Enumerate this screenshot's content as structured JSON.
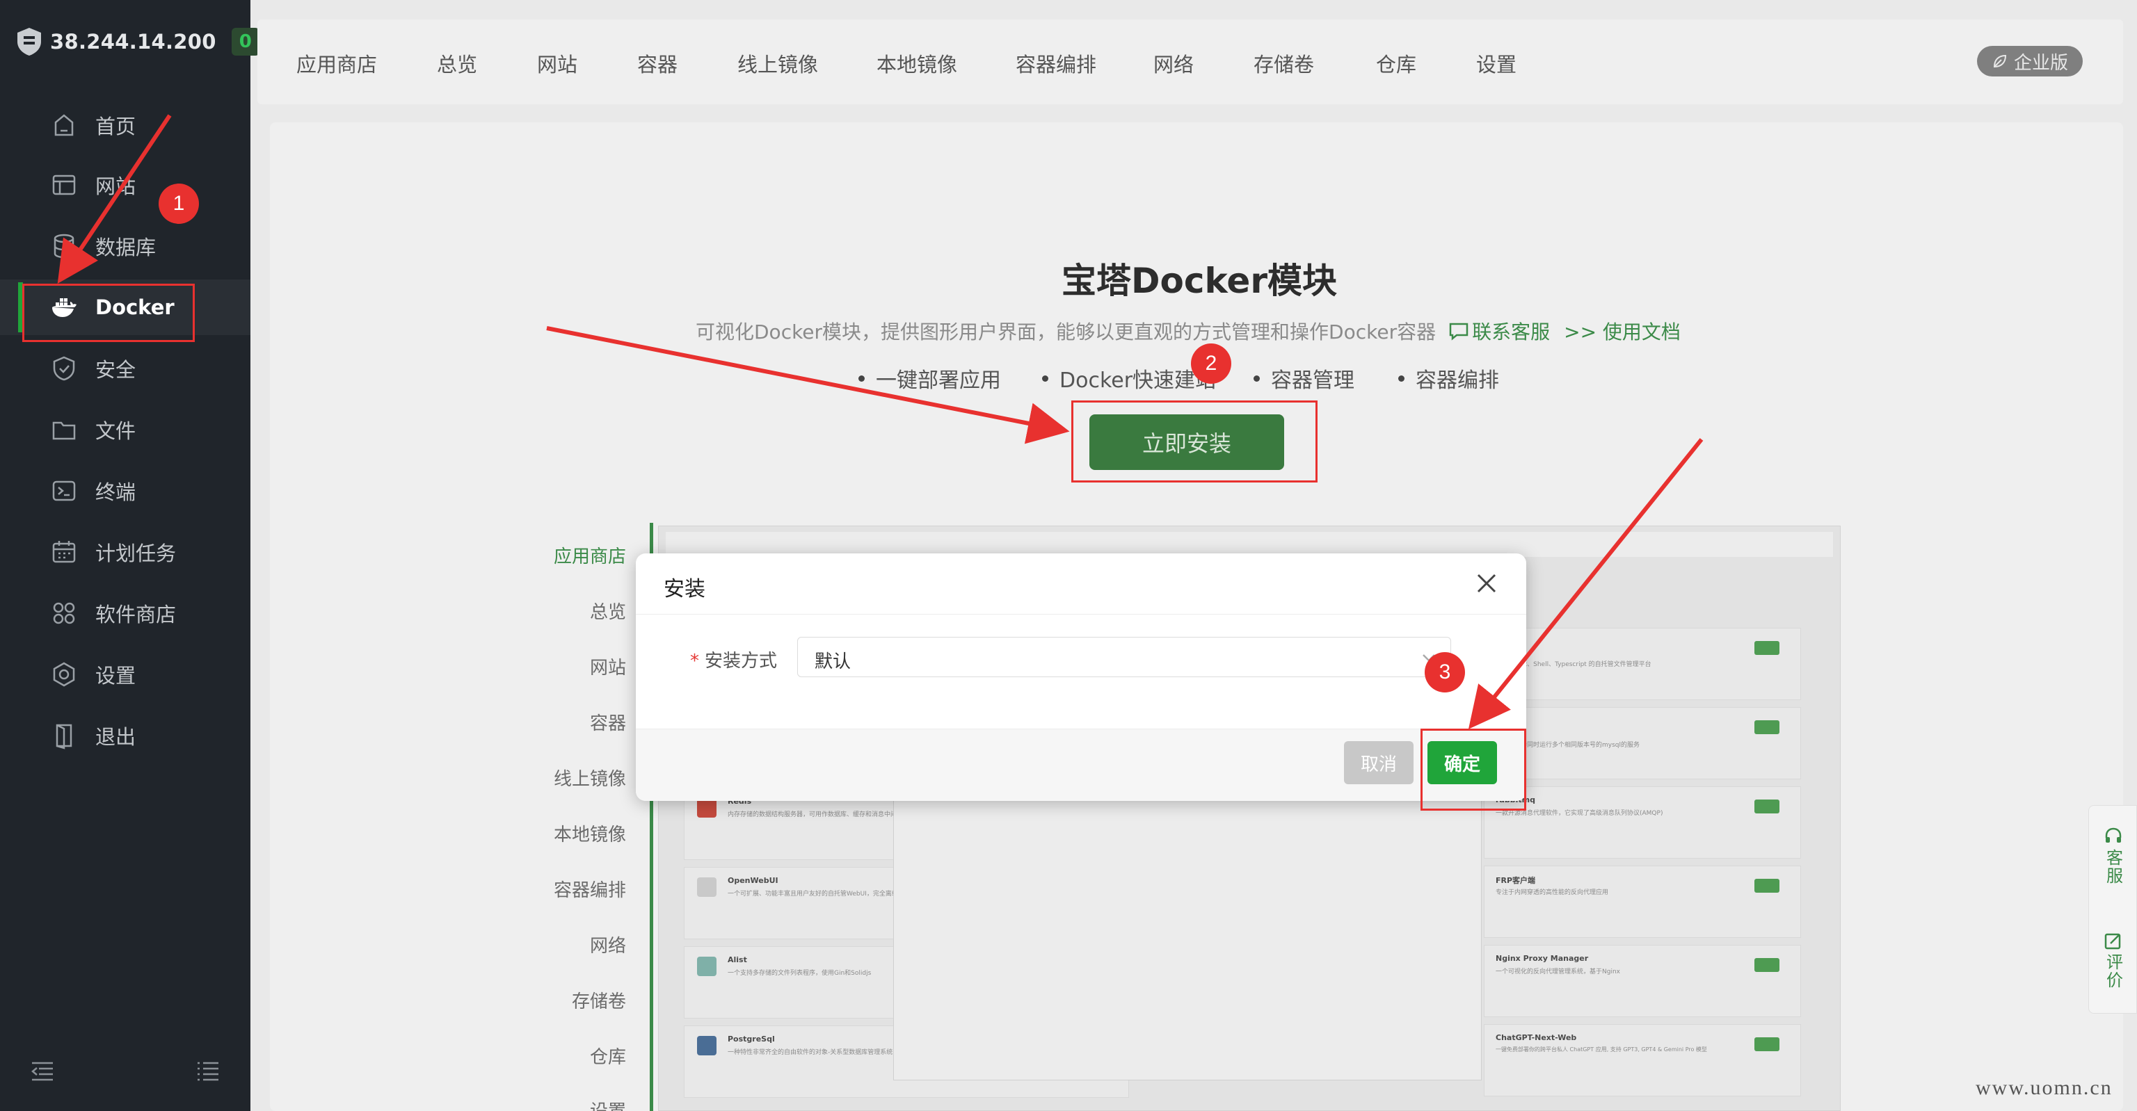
{
  "sidebar": {
    "server_ip": "38.244.14.200",
    "badge_count": "0",
    "items": [
      {
        "label": "首页",
        "icon": "home-icon"
      },
      {
        "label": "网站",
        "icon": "website-icon"
      },
      {
        "label": "数据库",
        "icon": "database-icon"
      },
      {
        "label": "Docker",
        "icon": "docker-icon",
        "active": true
      },
      {
        "label": "安全",
        "icon": "shield-icon"
      },
      {
        "label": "文件",
        "icon": "folder-icon"
      },
      {
        "label": "终端",
        "icon": "terminal-icon"
      },
      {
        "label": "计划任务",
        "icon": "calendar-icon"
      },
      {
        "label": "软件商店",
        "icon": "apps-icon"
      },
      {
        "label": "设置",
        "icon": "gear-icon"
      },
      {
        "label": "退出",
        "icon": "logout-icon"
      }
    ]
  },
  "topnav": {
    "tabs": [
      "应用商店",
      "总览",
      "网站",
      "容器",
      "线上镜像",
      "本地镜像",
      "容器编排",
      "网络",
      "存储卷",
      "仓库",
      "设置"
    ],
    "enterprise_label": "企业版"
  },
  "main": {
    "title": "宝塔Docker模块",
    "subtitle": "可视化Docker模块，提供图形用户界面，能够以更直观的方式管理和操作Docker容器",
    "contact_link": "联系客服",
    "docs_link": ">> 使用文档",
    "features": [
      "一键部署应用",
      "Docker快速建站",
      "容器管理",
      "容器编排"
    ],
    "install_button": "立即安装"
  },
  "preview": {
    "nav": [
      "应用商店",
      "总览",
      "网站",
      "容器",
      "线上镜像",
      "本地镜像",
      "容器编排",
      "网络",
      "存储卷",
      "仓库",
      "设置"
    ],
    "cards_left": [
      {
        "title": "Redis",
        "desc": "内存存储的数据结构服务器，可用作数据库、缓存和消息中间件"
      },
      {
        "title": "OpenWebUI",
        "desc": "一个可扩展、功能丰富且用户友好的自托管WebUI，完全离线运行"
      },
      {
        "title": "Alist",
        "desc": "一个支持多存储的文件列表程序，使用Gin和Solidjs"
      },
      {
        "title": "PostgreSql",
        "desc": "一种特性非常齐全的自由软件的对象-关系型数据库管理系统"
      }
    ],
    "cards_right": [
      {
        "title": "",
        "desc": "JavaScript、Shell、Typescript 的自托管文件管理平台"
      },
      {
        "title": "",
        "desc": "管理，支持同时运行多个相同版本号的mysql的服务"
      },
      {
        "title": "rabbitmq",
        "desc": "一款开源消息代理软件，它实现了高级消息队列协议(AMQP)"
      },
      {
        "title": "FRP客户端",
        "desc": "专注于内网穿透的高性能的反向代理应用"
      },
      {
        "title": "Nginx Proxy Manager",
        "desc": "一个可视化的反向代理管理系统，基于Nginx"
      },
      {
        "title": "ChatGPT-Next-Web",
        "desc": "一键免费部署你的跨平台私人 ChatGPT 应用, 支持 GPT3, GPT4 & Gemini Pro 模型"
      }
    ]
  },
  "modal": {
    "title": "安装",
    "field_label": "安装方式",
    "required_mark": "*",
    "select_value": "默认",
    "cancel_label": "取消",
    "confirm_label": "确定"
  },
  "float_panel": {
    "service_label": "客服",
    "review_label": "评价"
  },
  "annotations": [
    "1",
    "2",
    "3"
  ],
  "watermark": "www.uomn.cn",
  "colors": {
    "accent_green": "#20a53a",
    "sidebar_bg": "#20252b",
    "annotation_red": "#e8312f"
  }
}
